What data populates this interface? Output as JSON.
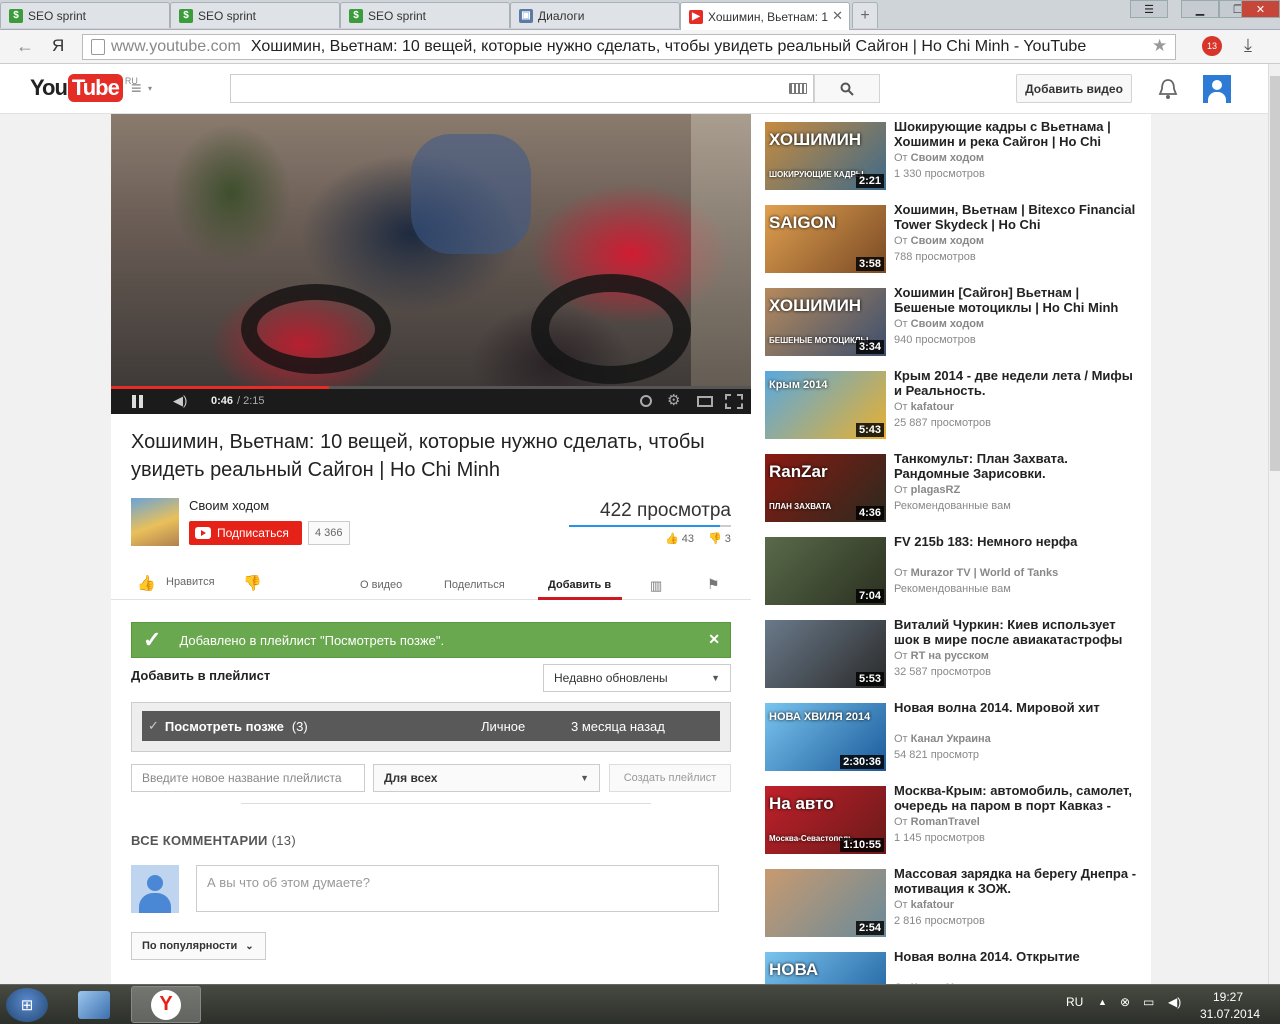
{
  "browser": {
    "tabs": [
      {
        "label": "SEO sprint",
        "type": "seo"
      },
      {
        "label": "SEO sprint",
        "type": "seo"
      },
      {
        "label": "SEO sprint",
        "type": "seo"
      },
      {
        "label": "Диалоги",
        "type": "dlg"
      },
      {
        "label": "Хошимин, Вьетнам: 1",
        "type": "yt",
        "active": true
      }
    ],
    "url_domain": "www.youtube.com",
    "url_title": "Хошимин, Вьетнам: 10 вещей, которые нужно сделать, чтобы увидеть реальный Сайгон | Ho Chi Minh - YouTube",
    "back_glyph": "←",
    "ya_glyph": "Я",
    "ext_badge": "13"
  },
  "header": {
    "logo_you": "You",
    "logo_tube": "Tube",
    "logo_region": "RU",
    "search_placeholder": "",
    "upload_label": "Добавить видео"
  },
  "player": {
    "time_current": "0:46",
    "time_total": "/ 2:15",
    "progress": 0.34
  },
  "video": {
    "title": "Хошимин, Вьетнам: 10 вещей, которые нужно сделать, чтобы увидеть реальный Сайгон | Ho Chi Minh",
    "channel": "Своим ходом",
    "subscribe_label": "Подписаться",
    "subscriber_count": "4 366",
    "views": "422 просмотра",
    "likes": "43",
    "dislikes": "3",
    "like_ratio": 0.93,
    "like_label": "Нравится"
  },
  "tabs": {
    "about": "О видео",
    "share": "Поделиться",
    "add_to": "Добавить в"
  },
  "playlist_panel": {
    "added_message": "Добавлено в плейлист \"Посмотреть позже\".",
    "heading": "Добавить в плейлист",
    "sort_label": "Недавно обновлены",
    "row": {
      "name": "Посмотреть позже",
      "count": "(3)",
      "privacy": "Личное",
      "updated": "3 месяца назад"
    },
    "new_playlist_placeholder": "Введите новое название плейлиста",
    "privacy_label": "Для всех",
    "create_label": "Создать плейлист"
  },
  "comments": {
    "heading": "ВСЕ КОММЕНТАРИИ",
    "count": "(13)",
    "placeholder": "А вы что об этом думаете?",
    "sort_label": "По популярности"
  },
  "sidebar": {
    "items": [
      {
        "title": "Шокирующие кадры с Вьетнама | Хошимин и река Сайгон | Ho Chi",
        "by_prefix": "От",
        "channel": "Своим ходом",
        "views": "1 330 просмотров",
        "duration": "2:21",
        "caption": "ХОШИМИН",
        "caption2": "ШОКИРУЮЩИЕ КАДРЫ",
        "color1": "#c68b3f",
        "color2": "#3e6a8a"
      },
      {
        "title": "Хошимин, Вьетнам | Bitexco Financial Tower Skydeck | Ho Chi",
        "by_prefix": "От",
        "channel": "Своим ходом",
        "views": "788 просмотров",
        "duration": "3:58",
        "caption": "SAIGON",
        "caption2": "",
        "color1": "#e0a050",
        "color2": "#7a4a25"
      },
      {
        "title": "Хошимин [Сайгон] Вьетнам | Бешеные мотоциклы | Ho Chi Minh",
        "by_prefix": "От",
        "channel": "Своим ходом",
        "views": "940 просмотров",
        "duration": "3:34",
        "caption": "ХОШИМИН",
        "caption2": "БЕШЕНЫЕ МОТОЦИКЛЫ",
        "color1": "#b58a5c",
        "color2": "#3c4f6e"
      },
      {
        "title": "Крым 2014 - две недели лета / Мифы и Реальность.",
        "by_prefix": "От",
        "channel": "kafatour",
        "views": "25 887 просмотров",
        "duration": "5:43",
        "caption": "Крым 2014",
        "caption2": "",
        "color1": "#58a8e0",
        "color2": "#e8b030"
      },
      {
        "title": "Танкомульт: План Захвата. Рандомные Зарисовки.",
        "by_prefix": "От",
        "channel": "plagasRZ",
        "views": "Рекомендованные вам",
        "duration": "4:36",
        "caption": "RanZar",
        "caption2": "ПЛАН ЗАХВАТА",
        "color1": "#8a1a12",
        "color2": "#2a2a1e"
      },
      {
        "title": "FV 215b 183: Немного нерфа",
        "by_prefix": "От",
        "channel": "Murazor TV | World of Tanks",
        "views": "Рекомендованные вам",
        "duration": "7:04",
        "caption": "",
        "caption2": "",
        "color1": "#5a6a4a",
        "color2": "#2a3020"
      },
      {
        "title": "Виталий Чуркин: Киев использует шок в мире после авиакатастрофы",
        "by_prefix": "От",
        "channel": "RT на русском",
        "views": "32 587 просмотров",
        "duration": "5:53",
        "caption": "",
        "caption2": "",
        "color1": "#6a7a8a",
        "color2": "#2a2a2a"
      },
      {
        "title": "Новая волна 2014. Мировой хит",
        "by_prefix": "От",
        "channel": "Канал Украина",
        "views": "54 821 просмотр",
        "duration": "2:30:36",
        "caption": "НОВА ХВИЛЯ 2014",
        "caption2": "",
        "color1": "#7ac4ee",
        "color2": "#1a5a9a"
      },
      {
        "title": "Москва-Крым: автомобиль, самолет, очередь на паром в порт Кавказ -",
        "by_prefix": "От",
        "channel": "RomanTravel",
        "views": "1 145 просмотров",
        "duration": "1:10:55",
        "caption": "На авто",
        "caption2": "Москва-Севастополь",
        "color1": "#c0202a",
        "color2": "#6a1a1a"
      },
      {
        "title": "Массовая зарядка на берегу Днепра - мотивация к ЗОЖ.",
        "by_prefix": "От",
        "channel": "kafatour",
        "views": "2 816 просмотров",
        "duration": "2:54",
        "caption": "",
        "caption2": "",
        "color1": "#c89a70",
        "color2": "#6a8a9a"
      },
      {
        "title": "Новая волна 2014. Открытие",
        "by_prefix": "От",
        "channel": "Канал Украина",
        "views": "",
        "duration": "",
        "caption": "НОВА",
        "caption2": "",
        "color1": "#7ac4ee",
        "color2": "#1a5a9a"
      }
    ]
  },
  "taskbar": {
    "lang": "RU",
    "time": "19:27",
    "date": "31.07.2014"
  }
}
